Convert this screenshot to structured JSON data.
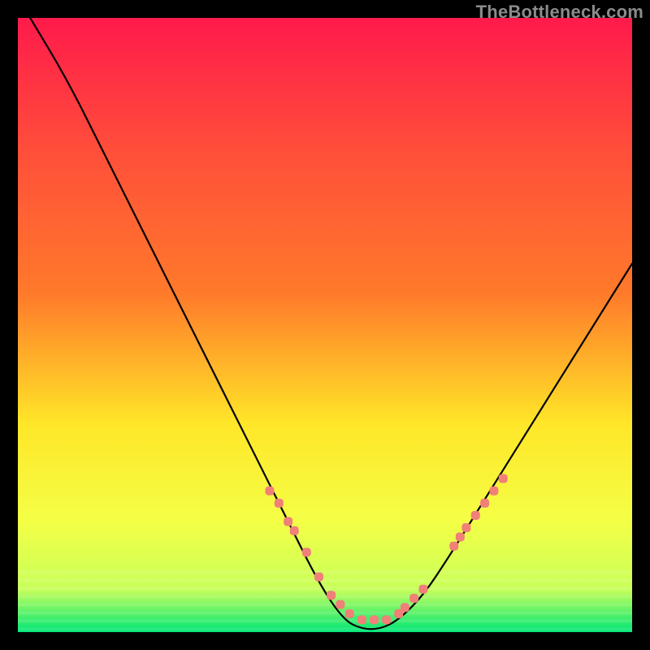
{
  "watermark": "TheBottleneck.com",
  "chart_data": {
    "type": "line",
    "title": "",
    "xlabel": "",
    "ylabel": "",
    "xlim": [
      0,
      100
    ],
    "ylim": [
      0,
      100
    ],
    "gradient_colors": {
      "top": "#ff1a4b",
      "upper_mid": "#ff7a2a",
      "mid": "#ffe628",
      "lower_mid": "#f4ff46",
      "lower": "#c8ff5a",
      "bottom": "#00e676"
    },
    "series": [
      {
        "name": "bottleneck-curve",
        "x": [
          2,
          8,
          14,
          20,
          26,
          32,
          38,
          44,
          49,
          53,
          56,
          59,
          62,
          66,
          70,
          75,
          80,
          85,
          90,
          95,
          100
        ],
        "values": [
          100,
          90,
          78,
          66,
          54,
          42,
          30,
          18,
          8,
          2,
          0.5,
          0.5,
          2,
          6,
          12,
          20,
          28,
          36,
          44,
          52,
          60
        ]
      }
    ],
    "markers": {
      "name": "highlight-dots",
      "color": "#f08078",
      "x": [
        41,
        42.5,
        44,
        45,
        47,
        49,
        51,
        52.5,
        54,
        56,
        58,
        60,
        62,
        63,
        64.5,
        66,
        71,
        72,
        73,
        74.5,
        76,
        77.5,
        79
      ],
      "values": [
        23,
        21,
        18,
        16.5,
        13,
        9,
        6,
        4.5,
        3,
        2,
        2,
        2,
        3,
        4,
        5.5,
        7,
        14,
        15.5,
        17,
        19,
        21,
        23,
        25
      ]
    }
  }
}
